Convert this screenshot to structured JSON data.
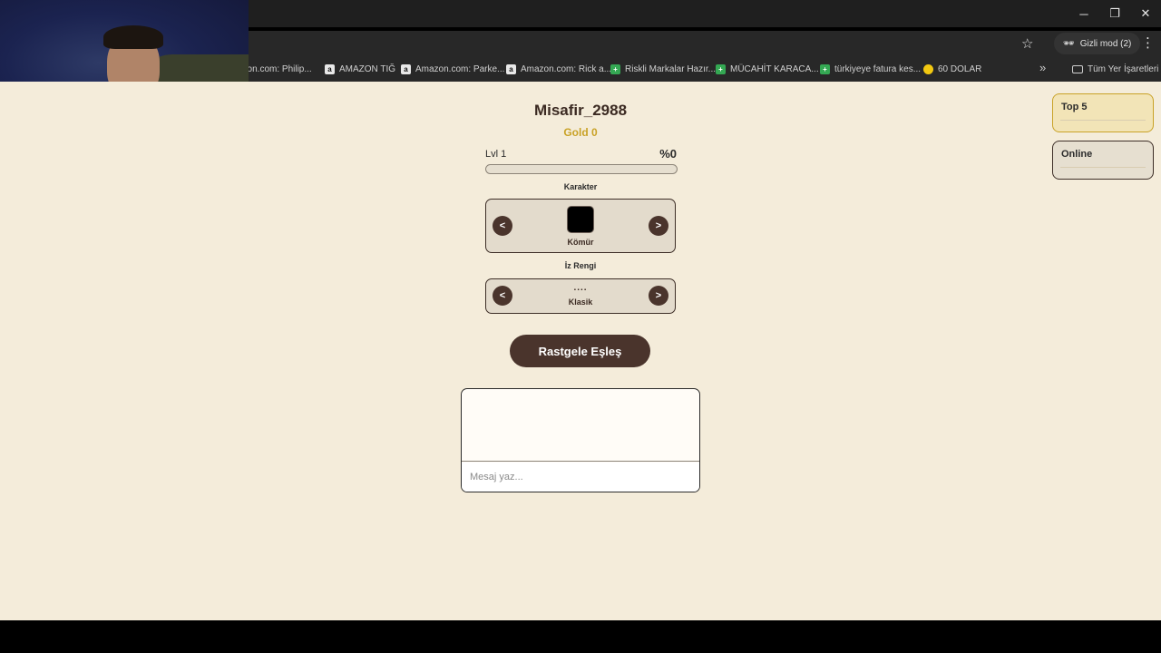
{
  "browser": {
    "incognito_label": "Gizli mod (2)",
    "bookmarks": [
      {
        "label": "azon.com: Philip...",
        "icon": "a"
      },
      {
        "label": "AMAZON TIĞ",
        "icon": "a"
      },
      {
        "label": "Amazon.com: Parke...",
        "icon": "a"
      },
      {
        "label": "Amazon.com: Rick a...",
        "icon": "a"
      },
      {
        "label": "Riskli Markalar Hazır...",
        "icon": "plus"
      },
      {
        "label": "MÜCAHİT KARACA...",
        "icon": "plus"
      },
      {
        "label": "türkiyeye fatura kes...",
        "icon": "plus"
      },
      {
        "label": "60 DOLAR",
        "icon": "coin"
      }
    ],
    "more_label": "»",
    "all_bookmarks_label": "Tüm Yer İşaretleri"
  },
  "player": {
    "username": "Misafir_2988",
    "gold": "Gold 0",
    "level": "Lvl 1",
    "xp_percent_label": "%0",
    "xp_progress": 0
  },
  "character": {
    "section_label": "Karakter",
    "prev_label": "<",
    "next_label": ">",
    "selected_name": "Kömür",
    "selected_color": "#000000"
  },
  "trail": {
    "section_label": "İz Rengi",
    "prev_label": "<",
    "next_label": ">",
    "preview": "....",
    "selected_name": "Klasik"
  },
  "match_button": "Rastgele Eşleş",
  "chat": {
    "placeholder": "Mesaj yaz..."
  },
  "sidebar": {
    "top5_label": "Top 5",
    "online_label": "Online"
  },
  "colors": {
    "page_bg": "#f4ecda",
    "accent_brown": "#4a342c",
    "gold": "#c9a227"
  }
}
